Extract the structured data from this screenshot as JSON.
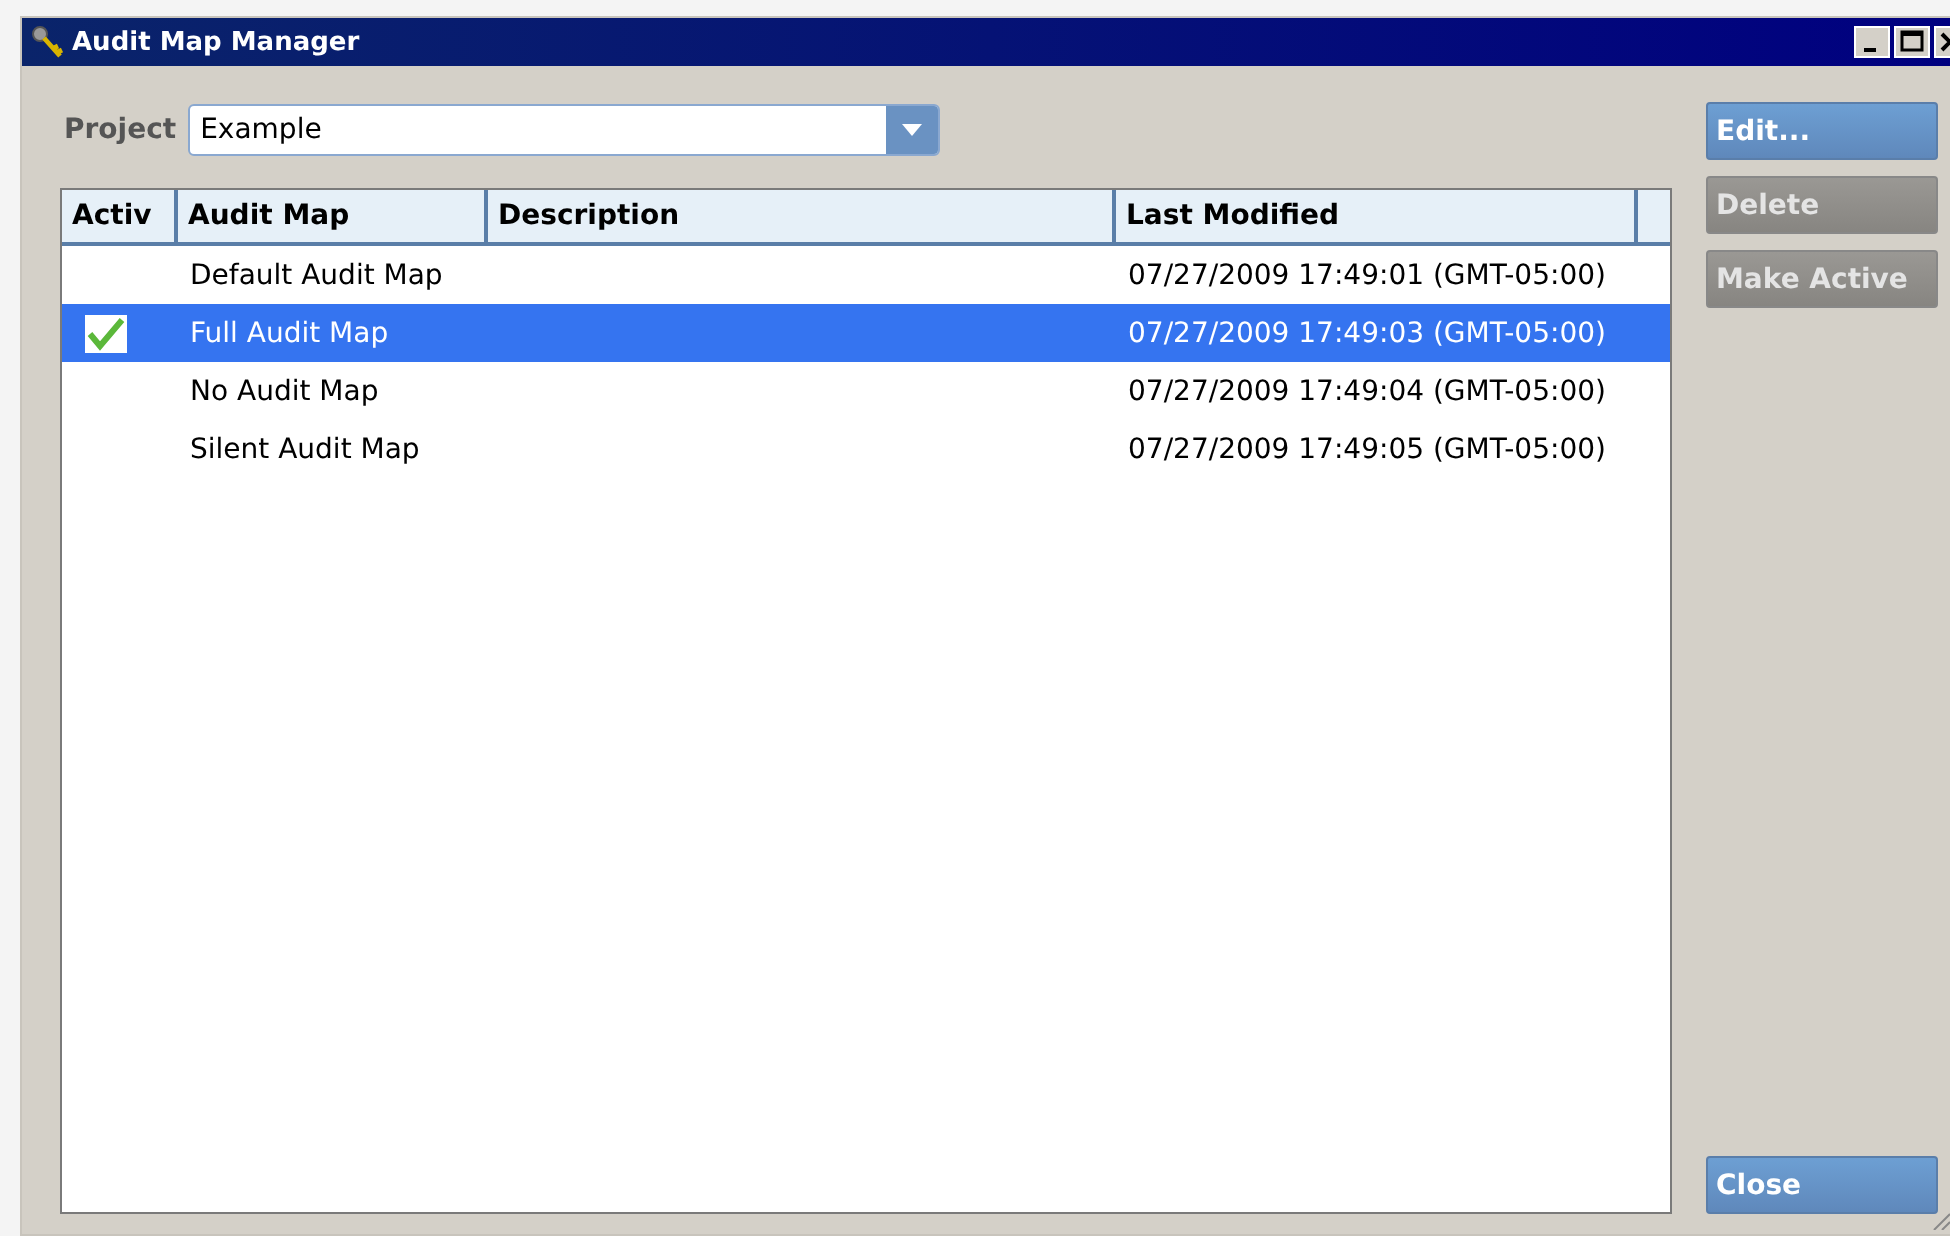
{
  "window": {
    "title": "Audit Map Manager"
  },
  "project": {
    "label": "Project",
    "value": "Example"
  },
  "table": {
    "columns": [
      "Activ",
      "Audit Map",
      "Description",
      "Last Modified"
    ],
    "rows": [
      {
        "active": false,
        "selected": false,
        "name": "Default Audit Map",
        "description": "",
        "modified": "07/27/2009 17:49:01 (GMT-05:00)"
      },
      {
        "active": true,
        "selected": true,
        "name": "Full Audit Map",
        "description": "",
        "modified": "07/27/2009 17:49:03 (GMT-05:00)"
      },
      {
        "active": false,
        "selected": false,
        "name": "No Audit Map",
        "description": "",
        "modified": "07/27/2009 17:49:04 (GMT-05:00)"
      },
      {
        "active": false,
        "selected": false,
        "name": "Silent Audit Map",
        "description": "",
        "modified": "07/27/2009 17:49:05 (GMT-05:00)"
      }
    ]
  },
  "buttons": [
    {
      "label": "Edit...",
      "disabled": false
    },
    {
      "label": "Delete",
      "disabled": true
    },
    {
      "label": "Make Active",
      "disabled": true
    }
  ],
  "close_button": {
    "label": "Close"
  }
}
